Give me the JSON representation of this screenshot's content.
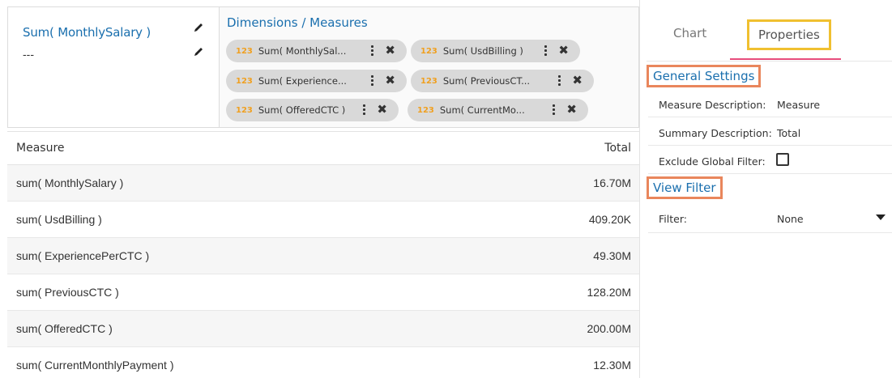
{
  "summary": {
    "title": "Sum( MonthlySalary )",
    "subtitle": "---"
  },
  "dimensions": {
    "title": "Dimensions / Measures",
    "chips": [
      {
        "type": "123",
        "label": "Sum( MonthlySal..."
      },
      {
        "type": "123",
        "label": "Sum( UsdBilling )"
      },
      {
        "type": "123",
        "label": "Sum( Experience..."
      },
      {
        "type": "123",
        "label": "Sum( PreviousCT..."
      },
      {
        "type": "123",
        "label": "Sum( OfferedCTC )"
      },
      {
        "type": "123",
        "label": "Sum( CurrentMo..."
      }
    ]
  },
  "table": {
    "headers": {
      "measure": "Measure",
      "total": "Total"
    },
    "rows": [
      {
        "measure": "sum( MonthlySalary )",
        "total": "16.70M"
      },
      {
        "measure": "sum( UsdBilling )",
        "total": "409.20K"
      },
      {
        "measure": "sum( ExperiencePerCTC )",
        "total": "49.30M"
      },
      {
        "measure": "sum( PreviousCTC )",
        "total": "128.20M"
      },
      {
        "measure": "sum( OfferedCTC )",
        "total": "200.00M"
      },
      {
        "measure": "sum( CurrentMonthlyPayment )",
        "total": "12.30M"
      }
    ]
  },
  "properties": {
    "tabs": {
      "chart": "Chart",
      "properties": "Properties"
    },
    "general_settings": "General Settings",
    "measure_description_label": "Measure Description:",
    "measure_description_value": "Measure",
    "summary_description_label": "Summary Description:",
    "summary_description_value": "Total",
    "exclude_global_filter_label": "Exclude Global Filter:",
    "view_filter": "View Filter",
    "filter_label": "Filter:",
    "filter_value": "None"
  },
  "colors": {
    "accent_blue": "#1a6fae",
    "highlight_yellow": "#f0c030",
    "highlight_orange": "#e9865c",
    "tab_underline": "#e74c7c",
    "chip_type": "#f0a020"
  }
}
